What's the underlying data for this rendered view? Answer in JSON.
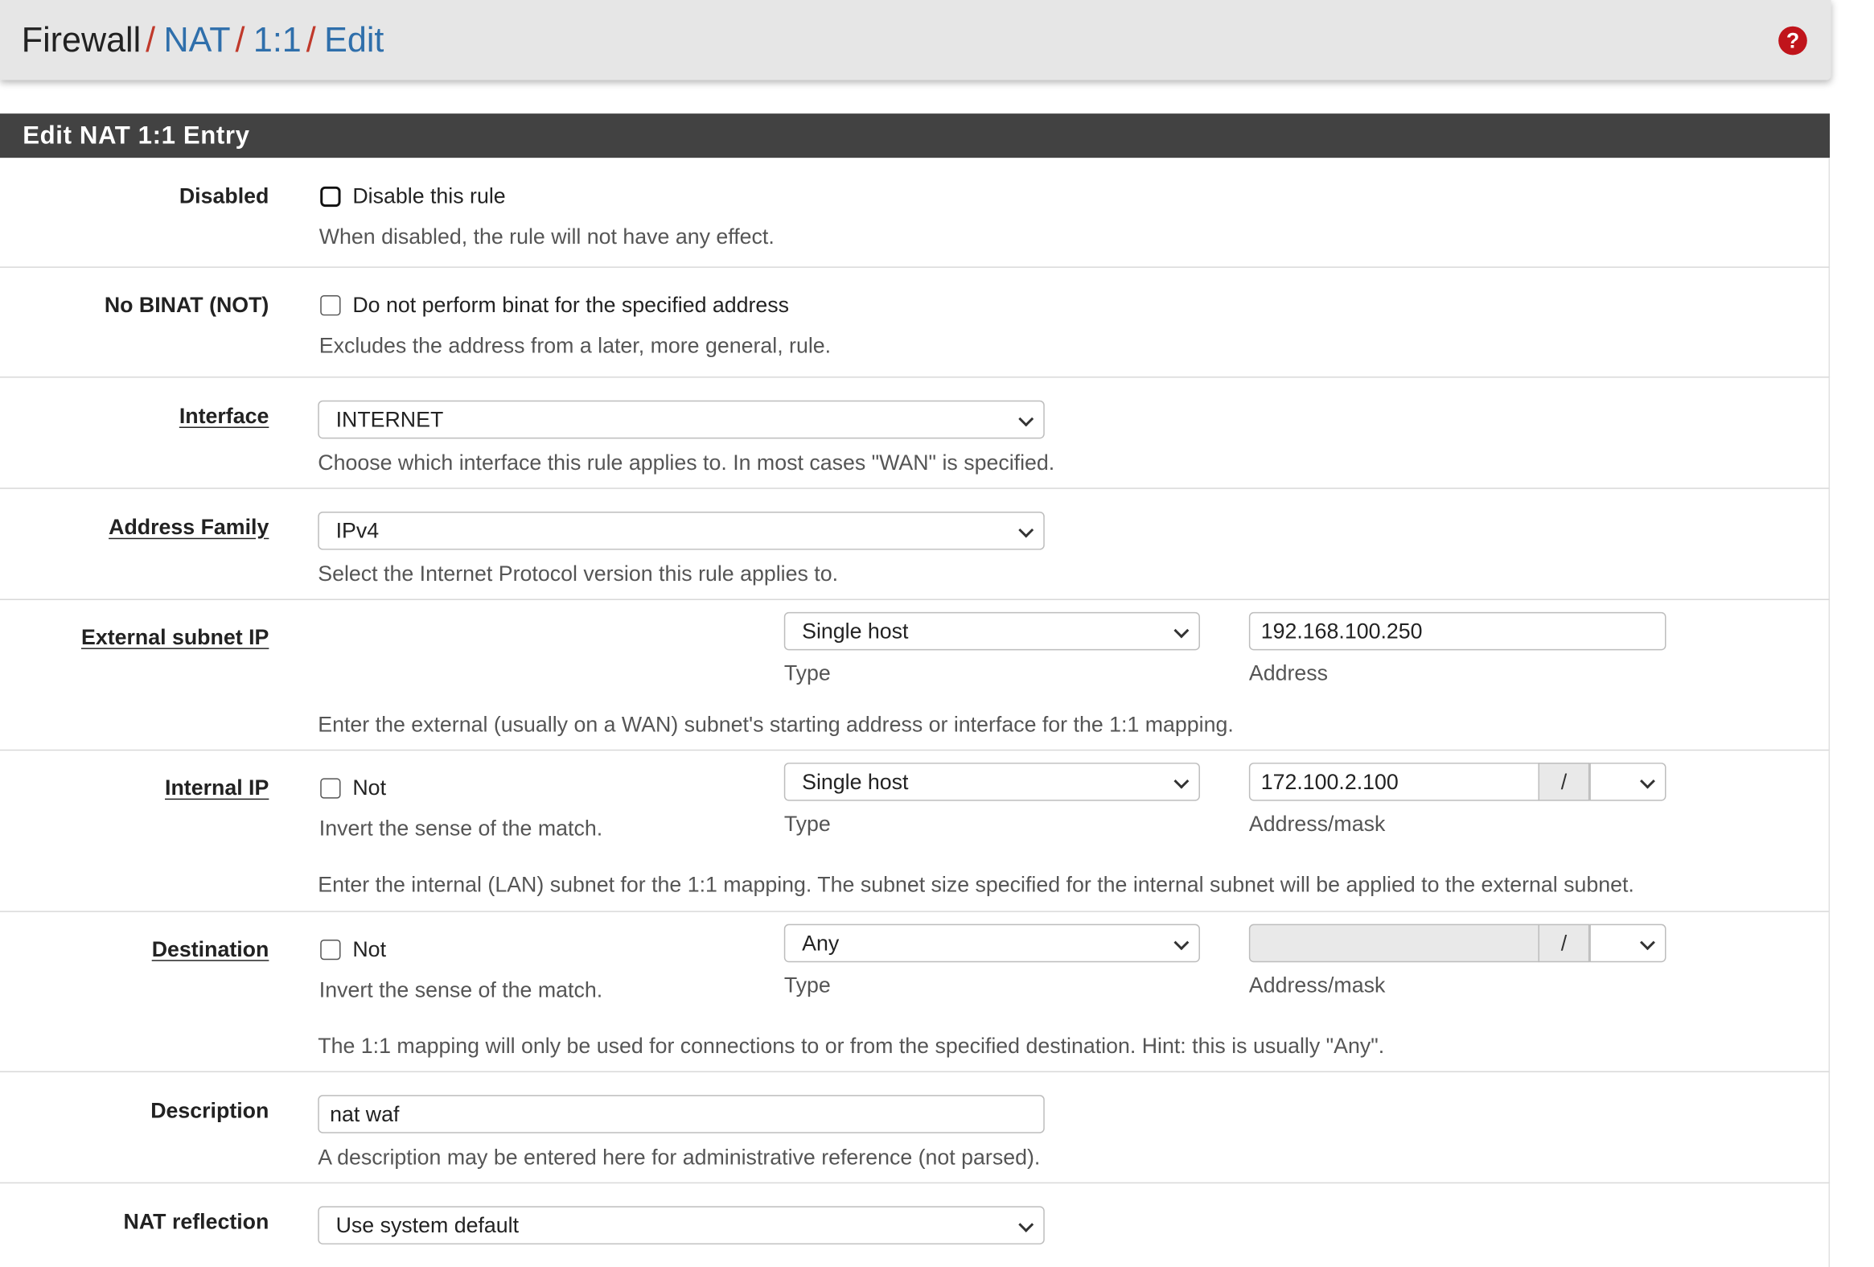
{
  "breadcrumb": {
    "root": "Firewall",
    "separator": "/",
    "items": [
      "NAT",
      "1:1",
      "Edit"
    ]
  },
  "panel_title": "Edit NAT 1:1 Entry",
  "fields": {
    "disabled": {
      "label": "Disabled",
      "checkbox_label": "Disable this rule",
      "checked": false,
      "help": "When disabled, the rule will not have any effect."
    },
    "nobinat": {
      "label": "No BINAT (NOT)",
      "checkbox_label": "Do not perform binat for the specified address",
      "checked": false,
      "help": "Excludes the address from a later, more general, rule."
    },
    "interface": {
      "label": "Interface",
      "value": "INTERNET",
      "help": "Choose which interface this rule applies to. In most cases \"WAN\" is specified."
    },
    "address_family": {
      "label": "Address Family",
      "value": "IPv4",
      "help": "Select the Internet Protocol version this rule applies to."
    },
    "external": {
      "label": "External subnet IP",
      "type_value": "Single host",
      "type_caption": "Type",
      "address_value": "192.168.100.250",
      "address_caption": "Address",
      "help": "Enter the external (usually on a WAN) subnet's starting address or interface for the 1:1 mapping."
    },
    "internal": {
      "label": "Internal IP",
      "not_label": "Not",
      "not_help": "Invert the sense of the match.",
      "type_value": "Single host",
      "type_caption": "Type",
      "address_value": "172.100.2.100",
      "mask_separator": "/",
      "mask_value": "",
      "address_caption": "Address/mask",
      "help": "Enter the internal (LAN) subnet for the 1:1 mapping. The subnet size specified for the internal subnet will be applied to the external subnet."
    },
    "destination": {
      "label": "Destination",
      "not_label": "Not",
      "not_help": "Invert the sense of the match.",
      "type_value": "Any",
      "type_caption": "Type",
      "address_value": "",
      "mask_separator": "/",
      "mask_value": "",
      "address_caption": "Address/mask",
      "help": "The 1:1 mapping will only be used for connections to or from the specified destination. Hint: this is usually \"Any\"."
    },
    "description": {
      "label": "Description",
      "value": "nat waf",
      "help": "A description may be entered here for administrative reference (not parsed)."
    },
    "nat_reflection": {
      "label": "NAT reflection",
      "value": "Use system default"
    }
  },
  "icons": {
    "help": "question-circle-icon",
    "dropdown": "chevron-down-icon"
  },
  "colors": {
    "link": "#2f6fab",
    "separator": "#c0392b",
    "panel_heading_bg": "#424242",
    "help_icon": "#c0141b"
  }
}
